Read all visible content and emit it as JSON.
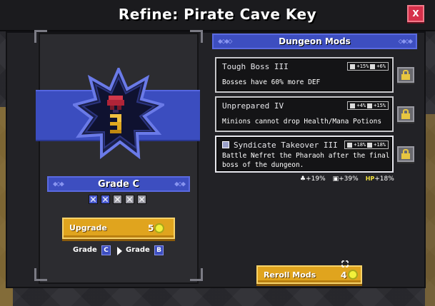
{
  "title": "Refine: Pirate Cave Key",
  "close_label": "X",
  "grade": {
    "title": "Grade C",
    "pips": [
      true,
      true,
      false,
      false,
      false
    ]
  },
  "upgrade": {
    "label": "Upgrade",
    "cost": "5"
  },
  "grade_change": {
    "from_label": "Grade",
    "from_grade": "C",
    "to_label": "Grade",
    "to_grade": "B"
  },
  "mods_header": "Dungeon Mods",
  "mods": [
    {
      "name": "Tough Boss III",
      "stat1": "+15%",
      "stat2": "+6%",
      "description_line1": "Bosses have 60% more DEF",
      "description_line2": ""
    },
    {
      "name": "Unprepared IV",
      "stat1": "+4%",
      "stat2": "+15%",
      "description_line1": "Minions cannot drop Health/Mana Potions",
      "description_line2": ""
    },
    {
      "name": "Syndicate Takeover III",
      "stat1": "+18%",
      "stat2": "+18%",
      "description_line1": "Battle Nefret the Pharaoh after the final",
      "description_line2": "boss of the dungeon."
    }
  ],
  "totals": {
    "t1": "+19%",
    "t2": "+39%",
    "hp_label": "HP",
    "t3": "+18%"
  },
  "reroll": {
    "label": "Reroll Mods",
    "cost": "4"
  },
  "colors": {
    "accent_blue": "#3d4ec0",
    "gold": "#e0a41e",
    "close_red": "#d6304a"
  }
}
